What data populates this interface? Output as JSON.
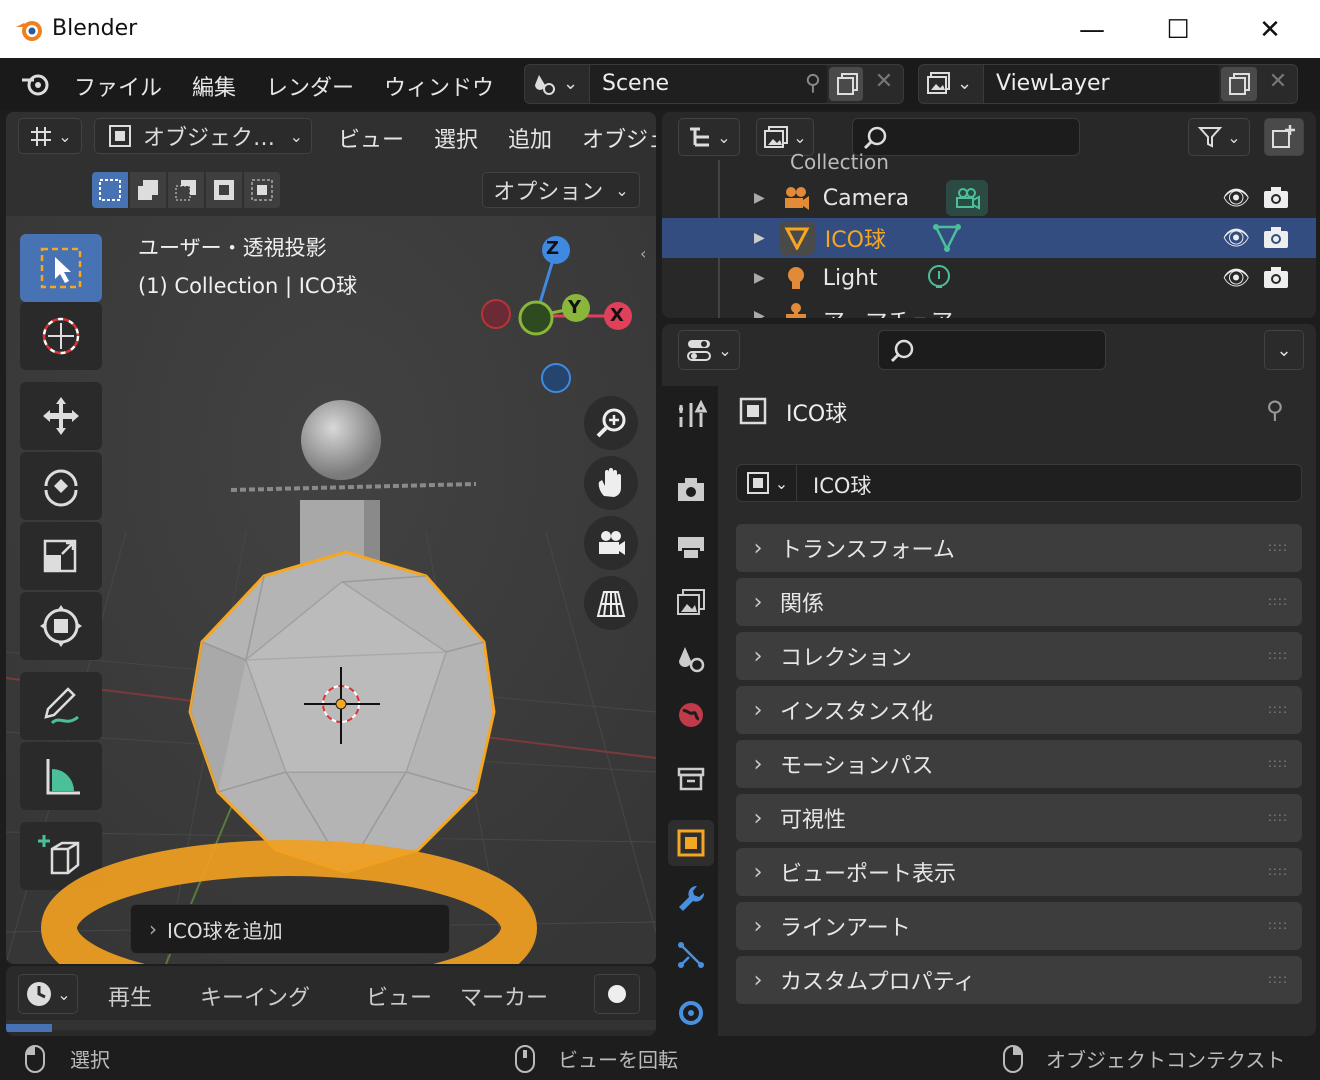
{
  "window": {
    "title": "Blender",
    "minimize": "—",
    "maximize": "☐",
    "close": "✕"
  },
  "menubar": {
    "items": [
      "ファイル",
      "編集",
      "レンダー",
      "ウィンドウ"
    ],
    "scene": "Scene",
    "view_layer": "ViewLayer"
  },
  "viewport": {
    "mode_label": "オブジェク…",
    "menu": [
      "ビュー",
      "選択",
      "追加",
      "オブジェ"
    ],
    "options": "オプション",
    "info_line1": "ユーザー・透視投影",
    "info_line2": "(1) Collection | ICO球",
    "gizmo": {
      "z": "Z",
      "y": "Y",
      "x": "X"
    },
    "last_op": "ICO球を追加"
  },
  "outliner": {
    "collection": "Collection",
    "rows": [
      "Camera",
      "ICO球",
      "Light",
      "アーマチュア"
    ],
    "selected_index": 1
  },
  "properties": {
    "object_name": "ICO球",
    "name_field": "ICO球",
    "panels": [
      "トランスフォーム",
      "関係",
      "コレクション",
      "インスタンス化",
      "モーションパス",
      "可視性",
      "ビューポート表示",
      "ラインアート",
      "カスタムプロパティ"
    ]
  },
  "timeline": {
    "menu": [
      "再生",
      "キーイング",
      "ビュー",
      "マーカー"
    ]
  },
  "statusbar": {
    "left": "選択",
    "middle": "ビューを回転",
    "right": "オブジェクトコンテクスト"
  },
  "colors": {
    "accent_selected": "#334d80",
    "active_orange": "#f5a623",
    "highlight_ring": "#f0a020",
    "axis_x": "#e0405a",
    "axis_y": "#8ab63c",
    "axis_z": "#3f8ae0"
  }
}
